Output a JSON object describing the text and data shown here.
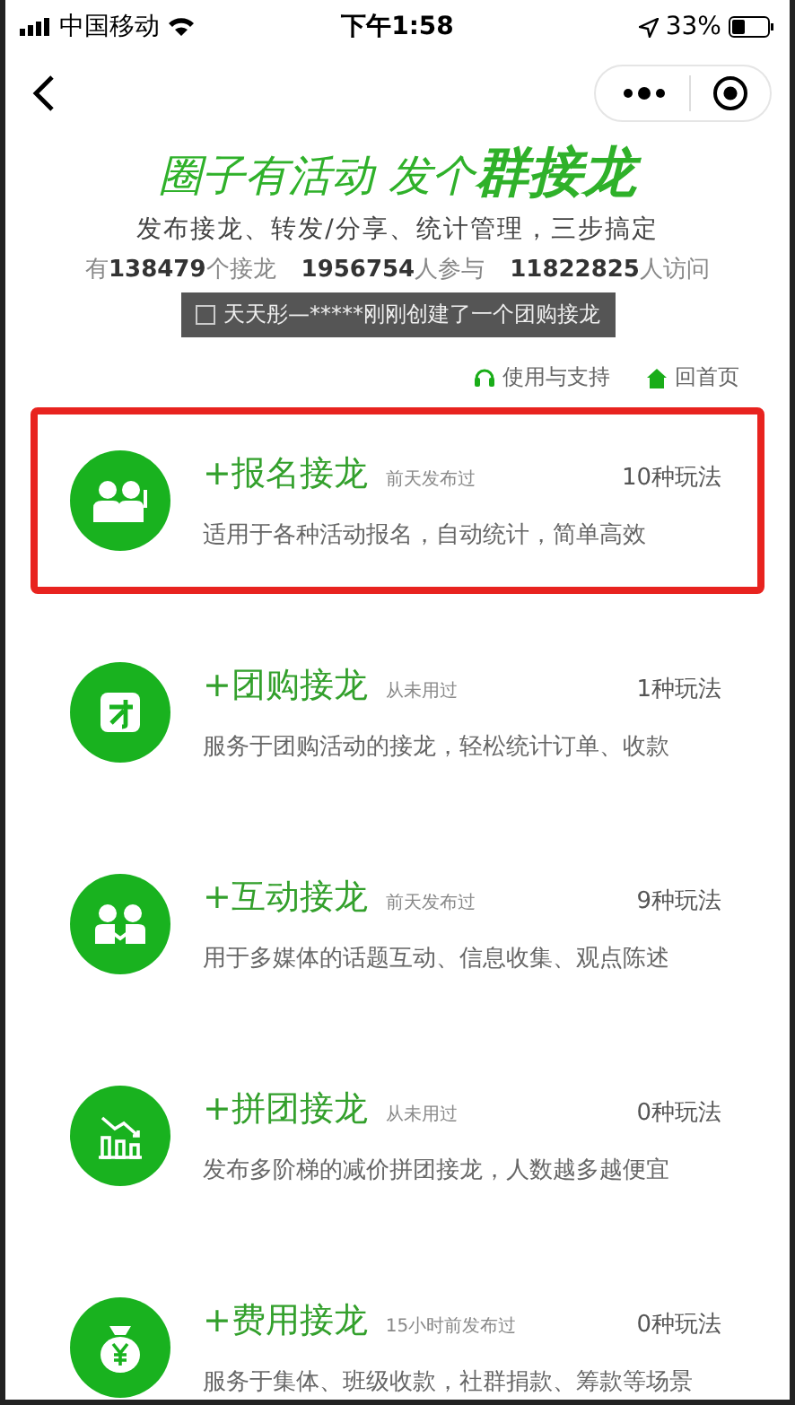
{
  "status_bar": {
    "carrier": "中国移动",
    "time": "下午1:58",
    "battery": "33%"
  },
  "header": {
    "headline": "圈子有活动 发个**群接龙**",
    "subtitle": "发布接龙、转发/分享、统计管理，三步搞定",
    "stats": [
      "有**138479**个接龙",
      "**1956754**人参与",
      "**11822825**人访问"
    ],
    "ticker": "天天彤—*****刚刚创建了一个团购接龙"
  },
  "links": [
    {
      "kind": "support",
      "label": "使用与支持"
    },
    {
      "kind": "home",
      "label": "回首页"
    }
  ],
  "items": [
    {
      "kind": "signup",
      "title": "+报名接龙",
      "note": "前天发布过",
      "count": "10种玩法",
      "desc": "适用于各种活动报名，自动统计，简单高效",
      "highlighted": true
    },
    {
      "kind": "group_buy",
      "title": "+团购接龙",
      "note": "从未用过",
      "count": "1种玩法",
      "desc": "服务于团购活动的接龙，轻松统计订单、收款",
      "highlighted": false
    },
    {
      "kind": "interact",
      "title": "+互动接龙",
      "note": "前天发布过",
      "count": "9种玩法",
      "desc": "用于多媒体的话题互动、信息收集、观点陈述",
      "highlighted": false
    },
    {
      "kind": "pintuan",
      "title": "+拼团接龙",
      "note": "从未用过",
      "count": "0种玩法",
      "desc": "发布多阶梯的减价拼团接龙，人数越多越便宜",
      "highlighted": false
    },
    {
      "kind": "fee",
      "title": "+费用接龙",
      "note": "15小时前发布过",
      "count": "0种玩法",
      "desc": "服务于集体、班级收款，社群捐款、筹款等场景",
      "highlighted": false
    }
  ]
}
